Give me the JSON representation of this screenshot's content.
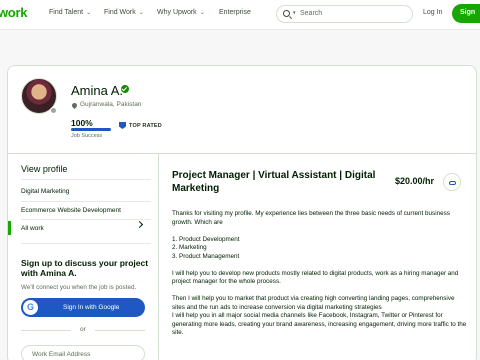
{
  "nav": {
    "logo": "work",
    "links": [
      "Find Talent",
      "Find Work",
      "Why Upwork",
      "Enterprise"
    ],
    "search_placeholder": "Search",
    "login": "Log In",
    "signup": "Sign"
  },
  "profile": {
    "name": "Amina A.",
    "location": "Gujranwala, Pakistan",
    "job_success_value": "100%",
    "job_success_label": "Job Success",
    "job_success_fraction": 1.0,
    "badge": "TOP RATED"
  },
  "sidebar": {
    "heading": "View profile",
    "items": [
      {
        "label": "Digital Marketing"
      },
      {
        "label": "Ecommerce Website Development"
      },
      {
        "label": "All work"
      }
    ],
    "active_index": 2
  },
  "signup_box": {
    "title": "Sign up to discuss your project with Amina A.",
    "subtitle": "We'll connect you when the job is posted.",
    "google_button": "Sign In with Google",
    "google_glyph": "G",
    "or": "or",
    "email_placeholder": "Work Email Address"
  },
  "main": {
    "title": "Project Manager | Virtual Assistant | Digital Marketing",
    "rate": "$20.00/hr",
    "description": [
      "Thanks for visiting my profile. My experience lies between the three basic needs of current business growth. Which are",
      "",
      "1. Product Development",
      "2. Marketing",
      "3. Product Management",
      "",
      "I will help you to develop new products mostly related to digital products, work as a hiring manager and project manager for the whole process.",
      "",
      "Then I will help you to market that product via creating high converting landing pages, comprehensive sites and the run ads to increase conversion via digital marketing strategies",
      "I will help you in all major social media channels like Facebook, Instagram, Twitter or Pinterest for generating more leads, creating your brand awareness, increasing engagement, driving more traffic to the site."
    ]
  },
  "colors": {
    "brand_green": "#14a800",
    "accent_blue": "#1f57c3",
    "text_dark": "#001e00",
    "text_muted": "#5e6d55"
  }
}
